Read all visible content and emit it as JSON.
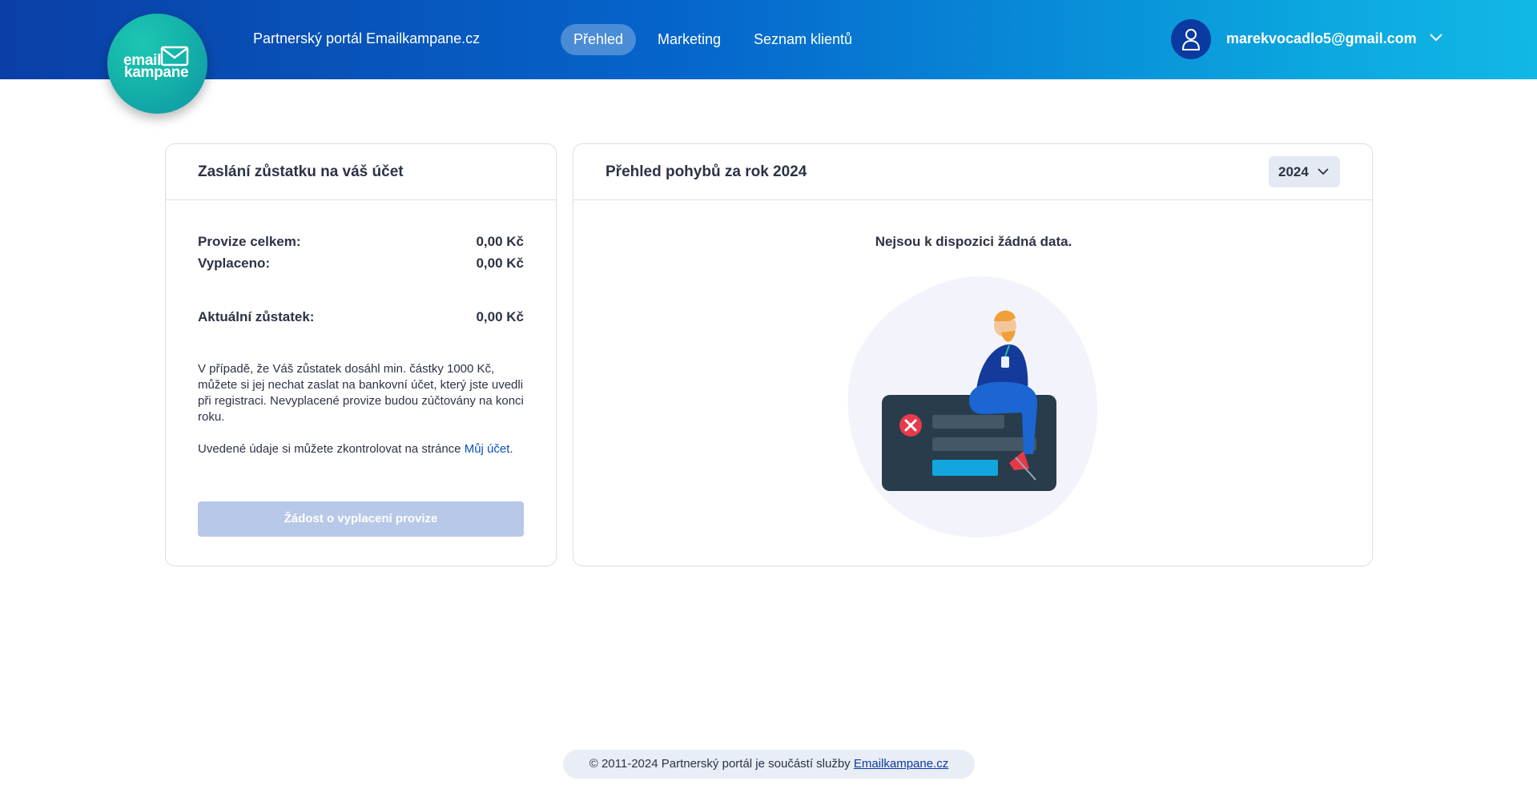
{
  "header": {
    "logo_line1": "email",
    "logo_line2": "kampane",
    "portal_title": "Partnerský portál Emailkampane.cz",
    "nav": [
      {
        "label": "Přehled",
        "active": true
      },
      {
        "label": "Marketing",
        "active": false
      },
      {
        "label": "Seznam klientů",
        "active": false
      }
    ],
    "user_email": "marekvocadlo5@gmail.com"
  },
  "balance_card": {
    "title": "Zaslání zůstatku na váš účet",
    "commission_label": "Provize celkem:",
    "commission_value": "0,00 Kč",
    "paid_label": "Vyplaceno:",
    "paid_value": "0,00 Kč",
    "balance_label": "Aktuální zůstatek:",
    "balance_value": "0,00 Kč",
    "info_text": "V případě, že Váš zůstatek dosáhl min. částky 1000 Kč, můžete si jej nechat zaslat na bankovní účet, který jste uvedli při registraci. Nevyplacené provize budou zúčtovány na konci roku.",
    "check_text": "Uvedené údaje si můžete zkontrolovat na stránce",
    "check_link": "Můj účet",
    "check_suffix": ".",
    "button_label": "Žádost o vyplacení provize"
  },
  "movements_card": {
    "title": "Přehled pohybů za rok 2024",
    "year_selected": "2024",
    "empty_message": "Nejsou k dispozici žádná data."
  },
  "footer": {
    "text": "© 2011-2024 Partnerský portál je součástí služby",
    "link": "Emailkampane.cz"
  },
  "colors": {
    "header_start": "#0a3fa6",
    "header_end": "#11b8e6",
    "logo": "#15b3a9",
    "button_disabled": "#b8c8e8",
    "link": "#0a4fb8"
  }
}
